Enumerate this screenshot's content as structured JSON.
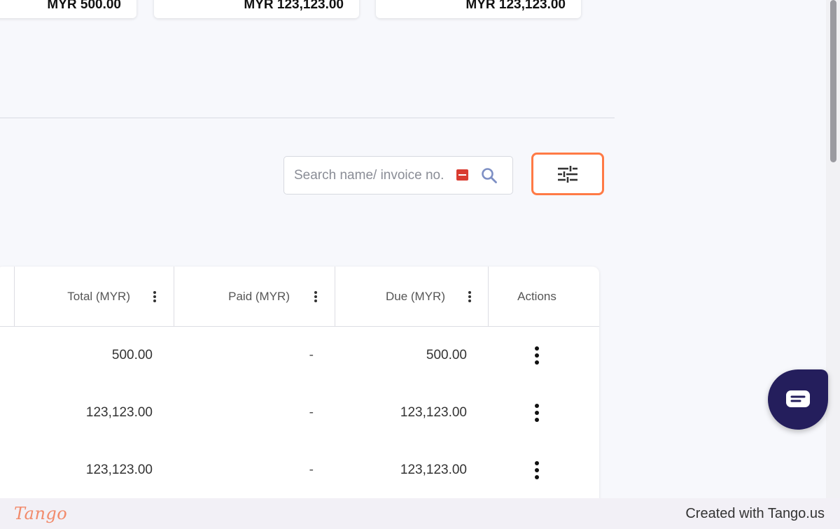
{
  "summary_cards": [
    {
      "amount": "MYR 500.00"
    },
    {
      "amount": "MYR 123,123.00"
    },
    {
      "amount": "MYR 123,123.00"
    }
  ],
  "search": {
    "placeholder": "Search name/ invoice no.",
    "value": ""
  },
  "table": {
    "columns": {
      "total": "Total (MYR)",
      "paid": "Paid (MYR)",
      "due": "Due (MYR)",
      "actions": "Actions"
    },
    "rows": [
      {
        "total": "500.00",
        "paid": "-",
        "due": "500.00"
      },
      {
        "total": "123,123.00",
        "paid": "-",
        "due": "123,123.00"
      },
      {
        "total": "123,123.00",
        "paid": "-",
        "due": "123,123.00"
      }
    ]
  },
  "footer": {
    "logo": "Tango",
    "text": "Created with Tango.us"
  },
  "colors": {
    "highlight": "#ff7a45",
    "chat": "#241e5c",
    "brand": "#f28a6b"
  },
  "icons": [
    "search-icon",
    "keyboard-shortcut-icon",
    "filter-sliders-icon",
    "column-menu-icon",
    "more-vertical-icon",
    "chat-icon"
  ]
}
